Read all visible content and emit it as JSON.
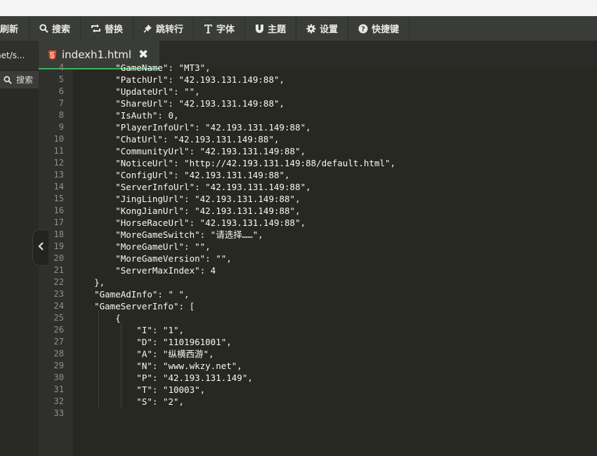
{
  "toolbar": {
    "items": [
      {
        "label": "刷新",
        "icon": "refresh-icon"
      },
      {
        "label": "搜索",
        "icon": "search-icon"
      },
      {
        "label": "替换",
        "icon": "replace-icon"
      },
      {
        "label": "跳转行",
        "icon": "pin-icon"
      },
      {
        "label": "字体",
        "icon": "font-icon"
      },
      {
        "label": "主题",
        "icon": "magnet-icon"
      },
      {
        "label": "设置",
        "icon": "gear-icon"
      },
      {
        "label": "快捷键",
        "icon": "help-icon"
      }
    ]
  },
  "tabs": {
    "left_label": "net/s...",
    "file_name": "indexh1.html",
    "close_glyph": "✖"
  },
  "sidebar": {
    "search_label": "搜索"
  },
  "colors": {
    "accent": "#3bb35c",
    "editor_bg": "#272822",
    "gutter_bg": "#2f302c",
    "html5_badge": "#e44d26"
  },
  "editor": {
    "lines": [
      {
        "n": "4",
        "text": "        \"GameName\": \"MT3\","
      },
      {
        "n": "5",
        "text": "        \"PatchUrl\": \"42.193.131.149:88\","
      },
      {
        "n": "6",
        "text": "        \"UpdateUrl\": \"\","
      },
      {
        "n": "7",
        "text": "        \"ShareUrl\": \"42.193.131.149:88\","
      },
      {
        "n": "8",
        "text": "        \"IsAuth\": 0,"
      },
      {
        "n": "9",
        "text": "        \"PlayerInfoUrl\": \"42.193.131.149:88\","
      },
      {
        "n": "10",
        "text": "        \"ChatUrl\": \"42.193.131.149:88\","
      },
      {
        "n": "11",
        "text": "        \"CommunityUrl\": \"42.193.131.149:88\","
      },
      {
        "n": "12",
        "text": "        \"NoticeUrl\": \"http://42.193.131.149:88/default.html\","
      },
      {
        "n": "13",
        "text": "        \"ConfigUrl\": \"42.193.131.149:88\","
      },
      {
        "n": "14",
        "text": "        \"ServerInfoUrl\": \"42.193.131.149:88\","
      },
      {
        "n": "15",
        "text": "        \"JingLingUrl\": \"42.193.131.149:88\","
      },
      {
        "n": "16",
        "text": "        \"KongJianUrl\": \"42.193.131.149:88\","
      },
      {
        "n": "17",
        "text": "        \"HorseRaceUrl\": \"42.193.131.149:88\","
      },
      {
        "n": "18",
        "text": "        \"MoreGameSwitch\": \"请选择……\","
      },
      {
        "n": "19",
        "text": "        \"MoreGameUrl\": \"\","
      },
      {
        "n": "20",
        "text": "        \"MoreGameVersion\": \"\","
      },
      {
        "n": "21",
        "text": "        \"ServerMaxIndex\": 4"
      },
      {
        "n": "22",
        "text": "    },"
      },
      {
        "n": "23",
        "text": "    \"GameAdInfo\": \" \","
      },
      {
        "n": "24",
        "text": "    \"GameServerInfo\": ["
      },
      {
        "n": "25",
        "text": "        {"
      },
      {
        "n": "26",
        "text": "            \"I\": \"1\","
      },
      {
        "n": "27",
        "text": "            \"D\": \"1101961001\","
      },
      {
        "n": "28",
        "text": "            \"A\": \"纵横西游\","
      },
      {
        "n": "29",
        "text": "            \"N\": \"www.wkzy.net\","
      },
      {
        "n": "30",
        "text": "            \"P\": \"42.193.131.149\","
      },
      {
        "n": "31",
        "text": "            \"T\": \"10003\","
      },
      {
        "n": "32",
        "text": "            \"S\": \"2\","
      },
      {
        "n": "33",
        "text": ""
      }
    ]
  }
}
